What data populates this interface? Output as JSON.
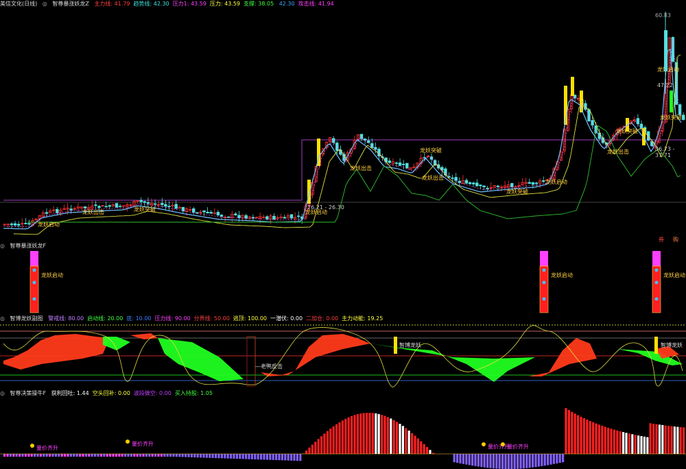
{
  "main": {
    "title": "美信文化(日线)",
    "indicator": "智尊暴涨妖龙Z",
    "params": [
      {
        "label": "主力线:",
        "value": "41.79",
        "color": "#ff4040"
      },
      {
        "label": "趋势线:",
        "value": "42.30",
        "color": "#40e0e0"
      },
      {
        "label": "压力1:",
        "value": "43.59",
        "color": "#ff40ff"
      },
      {
        "label": "压力:",
        "value": "43.59",
        "color": "#ffff40"
      },
      {
        "label": "支撑:",
        "value": "38.05",
        "color": "#40ff40"
      },
      {
        "label": "",
        "value": "42.30",
        "color": "#40a0ff"
      },
      {
        "label": "攻击线:",
        "value": "41.94",
        "color": "#ff40ff"
      }
    ],
    "price_high": "60.83",
    "price_marks": [
      "47.22 -",
      "36.73 - 37.71",
      "26.21 - 26.30"
    ],
    "signals": {
      "qidong": "龙妖启动",
      "chuji": "龙妖出击",
      "tupo": "龙妖突破"
    },
    "corner_icons": [
      "券",
      "购"
    ]
  },
  "panel2": {
    "title": "智尊暴涨妖龙F",
    "signal": "龙妖启动"
  },
  "panel3": {
    "title": "智博龙妖副图",
    "params": [
      {
        "label": "警戒线:",
        "value": "80.00",
        "color": "#c080ff"
      },
      {
        "label": "启动线:",
        "value": "20.00",
        "color": "#40ff40"
      },
      {
        "label": "底:",
        "value": "10.00",
        "color": "#4080ff"
      },
      {
        "label": "压力线:",
        "value": "90.00",
        "color": "#ff40ff"
      },
      {
        "label": "分界线:",
        "value": "50.00",
        "color": "#ff4040"
      },
      {
        "label": "逃顶:",
        "value": "100.00",
        "color": "#ffff40"
      },
      {
        "label": "一潜伏:",
        "value": "0.00",
        "color": "#ffffff"
      },
      {
        "label": "二加仓:",
        "value": "0.00",
        "color": "#ff4040"
      },
      {
        "label": "主力动能:",
        "value": "19.25",
        "color": "#ffff40"
      }
    ],
    "tags": [
      "智博龙妖",
      "—老鸭反击"
    ]
  },
  "panel4": {
    "title": "智尊决策操牛F",
    "params": [
      {
        "label": "获利回吐:",
        "value": "1.44",
        "color": "#ffffff"
      },
      {
        "label": "空头回补:",
        "value": "0.00",
        "color": "#ffff40"
      },
      {
        "label": "波段做空:",
        "value": "0.00",
        "color": "#c040ff"
      },
      {
        "label": "买入持股:",
        "value": "1.05",
        "color": "#40ff40"
      }
    ],
    "tag": "量价齐升"
  },
  "colors": {
    "up": "#ff3030",
    "down": "#50e0e0",
    "yellow": "#ffe000",
    "green": "#20ff20",
    "purple": "#a040ff",
    "magenta": "#ff40ff"
  }
}
